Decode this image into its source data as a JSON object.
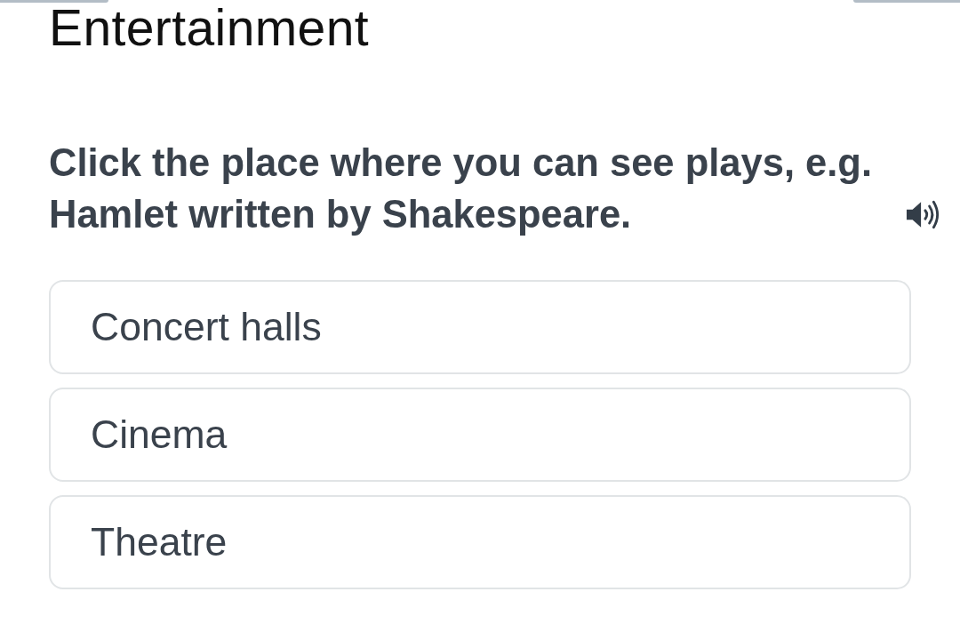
{
  "title": "Entertainment",
  "question": {
    "text": "Click the place where you can see plays, e.g. Hamlet written by Shakespeare."
  },
  "options": [
    {
      "label": "Concert halls",
      "selected": false
    },
    {
      "label": "Cinema",
      "selected": false
    },
    {
      "label": "Theatre",
      "selected": false
    }
  ]
}
